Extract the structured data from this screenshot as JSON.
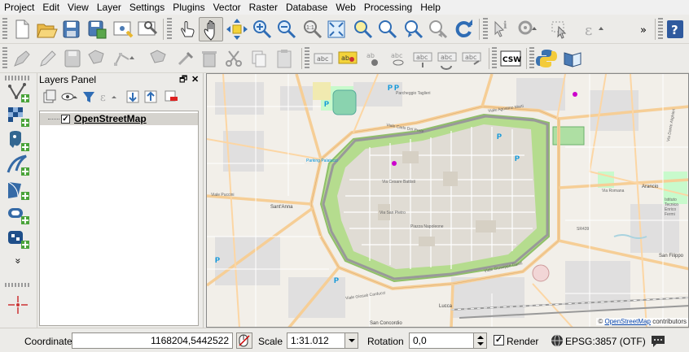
{
  "menu": [
    "Project",
    "Edit",
    "View",
    "Layer",
    "Settings",
    "Plugins",
    "Vector",
    "Raster",
    "Database",
    "Web",
    "Processing",
    "Help"
  ],
  "icons": {
    "toolbar1": [
      "new-project-icon",
      "open-project-icon",
      "save-project-icon",
      "save-as-icon",
      "new-print-composer-icon",
      "composer-manager-icon",
      "touch-zoom-icon",
      "pan-map-icon",
      "pan-to-selection-icon",
      "zoom-in-icon",
      "zoom-out-icon",
      "zoom-native-icon",
      "zoom-full-icon",
      "zoom-to-selection-icon",
      "zoom-to-layer-icon",
      "zoom-last-icon",
      "zoom-next-icon",
      "refresh-icon",
      "identify-icon",
      "measure-icon",
      "select-icon",
      "expression-select-icon",
      "overflow-chevron-icon",
      "help-icon"
    ],
    "toolbar2": [
      "current-edits-icon",
      "toggle-editing-icon",
      "save-edits-icon",
      "add-feature-icon",
      "node-tool-icon",
      "move-feature-icon",
      "delete-selected-icon",
      "cut-features-icon",
      "copy-features-icon",
      "paste-features-icon",
      "label-tool-icon",
      "pin-label-icon",
      "show-hide-label-icon",
      "move-label-icon",
      "rotate-label-icon",
      "change-label-icon",
      "csw-icon",
      "python-console-icon",
      "metasearch-icon"
    ]
  },
  "layers_panel": {
    "title": "Layers Panel",
    "float_glyph": "🗗",
    "close_glyph": "✕",
    "layers": [
      {
        "name": "OpenStreetMap",
        "checked": "✓"
      }
    ]
  },
  "left_toolbar": {
    "icons": [
      "add-vector-layer-icon",
      "add-raster-layer-icon",
      "add-postgis-layer-icon",
      "add-spatialite-layer-icon",
      "add-wms-layer-icon",
      "add-wcs-layer-icon",
      "add-wfs-layer-icon",
      "expand-chevron-icon",
      "gps-icon"
    ],
    "expand_glyph": "»"
  },
  "map": {
    "attribution_prefix": "© ",
    "attribution_link": "OpenStreetMap",
    "attribution_suffix": " contributors",
    "labels": {
      "parcheggio_taglieri": "Parcheggio Taglieri",
      "viale_agostino_marti": "Viale Agostino Marti",
      "viale_carlo_del_prete": "Viale Carlo Del Prete",
      "parking_palatucci": "Parking Palatucci",
      "via_cesare_battisti": "Via Cesare Battisti",
      "santanna": "Sant'Anna",
      "via_san_pietro": "Via San Pietro",
      "piazza_napoleone": "Piazza Napoleone",
      "viale_giosue_carducci": "Viale Giosuè Carducci",
      "viale_giuseppe_giusti": "Viale Giuseppe Giusti",
      "lucca": "Lucca",
      "san_concordio": "San Concordio",
      "via_romana": "Via Romana",
      "arancio": "Arancio",
      "san_filippo": "San Filippo",
      "sr439": "SR439",
      "istituto_tecnico": "Istituto Tecnico Enrico Fermi",
      "via_dante_alighieri": "Via Dante Alighieri",
      "viale_puccini": "Viale Puccini",
      "p": "P"
    }
  },
  "statusbar": {
    "coordinate_label": "Coordinate",
    "coordinate_value": "1168204,5442522",
    "scale_label": "Scale",
    "scale_value": "1:31.012",
    "rotation_label": "Rotation",
    "rotation_value": "0,0",
    "render_label": "Render",
    "render_checked": "✓",
    "crs": "EPSG:3857 (OTF)"
  },
  "colors": {
    "walls_green": "#b5dc8e",
    "primary_road": "#f6ce96",
    "old_town": "#e0dcd4",
    "water": "#a9d3df"
  }
}
